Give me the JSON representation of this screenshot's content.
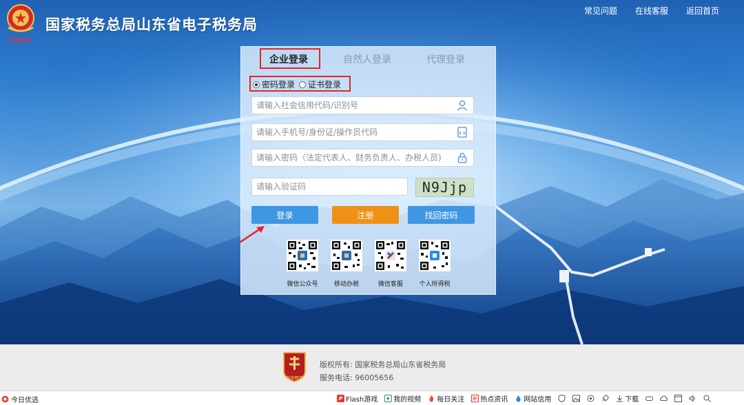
{
  "header": {
    "title": "国家税务总局山东省电子税务局",
    "emblem_caption": "中国税务",
    "links": [
      "常见问题",
      "在线客服",
      "返回首页"
    ]
  },
  "login": {
    "tabs": [
      "企业登录",
      "自然人登录",
      "代理登录"
    ],
    "active_tab": "企业登录",
    "modes": [
      "密码登录",
      "证书登录"
    ],
    "selected_mode": "密码登录",
    "placeholders": {
      "credit_code": "请输入社会信用代码/识别号",
      "account": "请输入手机号/身份证/操作员代码",
      "password": "请输入密码（法定代表人、财务负责人、办税人员)",
      "captcha": "请输入验证码"
    },
    "captcha_text": "N9Jjp",
    "buttons": {
      "login": "登录",
      "register": "注册",
      "recover": "找回密码"
    },
    "qr_codes": [
      "微信公众号",
      "移动办税",
      "微信客服",
      "个人所得税"
    ]
  },
  "footer": {
    "badge_text": "税务精英",
    "copyright": "版权所有: 国家税务总局山东省税务局",
    "phone": "服务电话: 96005656"
  },
  "statusbar": {
    "left": "今日优选",
    "items": [
      "Flash游戏",
      "我的视频",
      "每日关注",
      "热点资讯",
      "网站信用"
    ],
    "download": "下载"
  },
  "colors": {
    "accent_blue": "#3f97e3",
    "register_orange": "#f09117",
    "highlight_red": "#e52323"
  }
}
